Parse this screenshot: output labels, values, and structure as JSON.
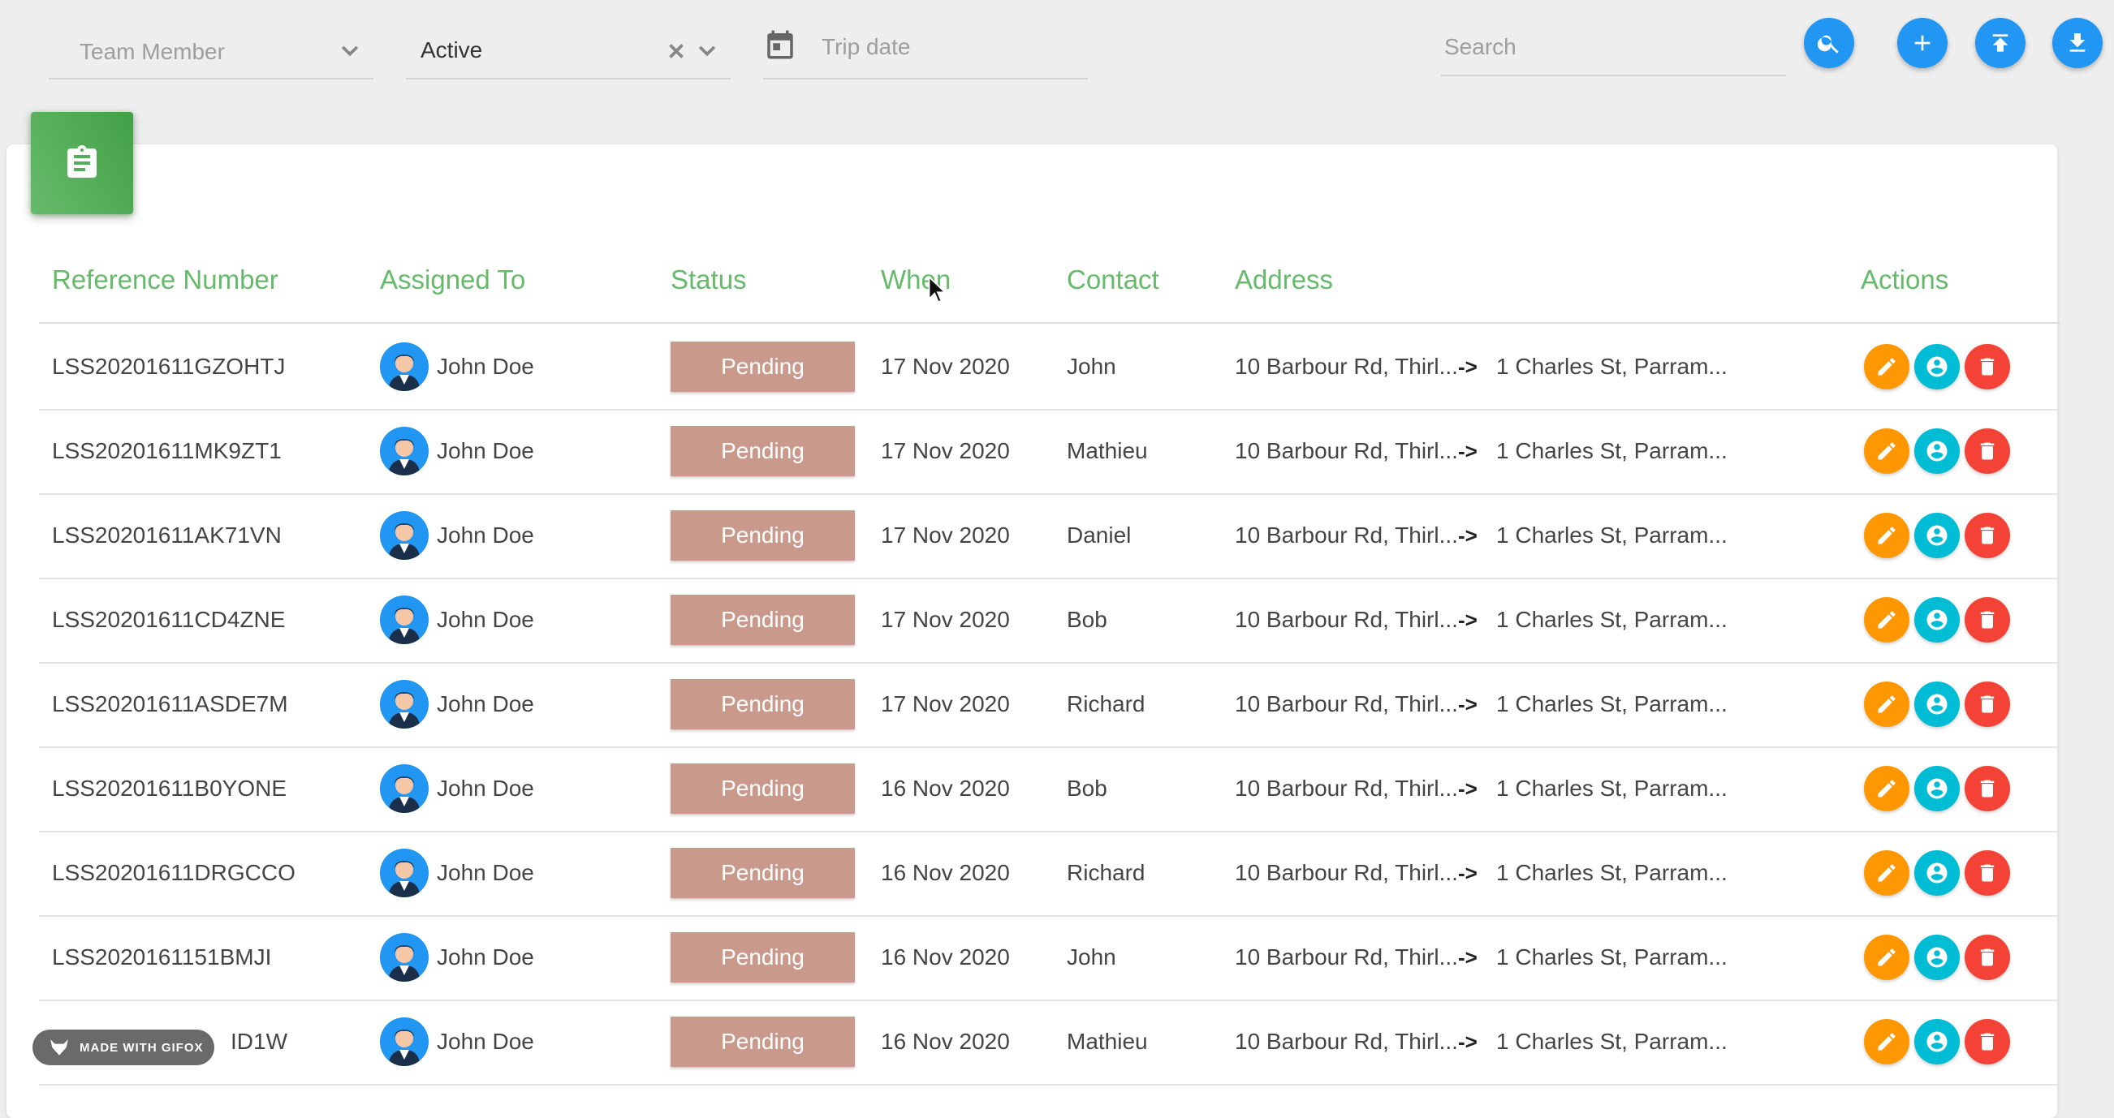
{
  "filters": {
    "team_member_placeholder": "Team Member",
    "status_value": "Active",
    "trip_date_placeholder": "Trip date",
    "search_placeholder": "Search"
  },
  "toolbar_icons": [
    "search-icon",
    "add-icon",
    "upload-icon",
    "download-icon"
  ],
  "colors": {
    "accent_blue": "#2196f3",
    "header_green": "#66bb6a",
    "pending_badge": "#c99a8b",
    "edit": "#ff9800",
    "assign": "#00bcd4",
    "delete": "#f44336"
  },
  "table": {
    "headers": {
      "reference": "Reference Number",
      "assigned": "Assigned To",
      "status": "Status",
      "when": "When",
      "contact": "Contact",
      "address": "Address",
      "actions": "Actions"
    },
    "rows": [
      {
        "reference": "LSS20201611GZOHTJ",
        "assigned": "John Doe",
        "status": "Pending",
        "when": "17 Nov 2020",
        "contact": "John",
        "from": "10 Barbour Rd, Thirl...",
        "sep": "->",
        "to": "1 Charles St, Parram..."
      },
      {
        "reference": "LSS20201611MK9ZT1",
        "assigned": "John Doe",
        "status": "Pending",
        "when": "17 Nov 2020",
        "contact": "Mathieu",
        "from": "10 Barbour Rd, Thirl...",
        "sep": "->",
        "to": "1 Charles St, Parram..."
      },
      {
        "reference": "LSS20201611AK71VN",
        "assigned": "John Doe",
        "status": "Pending",
        "when": "17 Nov 2020",
        "contact": "Daniel",
        "from": "10 Barbour Rd, Thirl...",
        "sep": "->",
        "to": "1 Charles St, Parram..."
      },
      {
        "reference": "LSS20201611CD4ZNE",
        "assigned": "John Doe",
        "status": "Pending",
        "when": "17 Nov 2020",
        "contact": "Bob",
        "from": "10 Barbour Rd, Thirl...",
        "sep": "->",
        "to": "1 Charles St, Parram..."
      },
      {
        "reference": "LSS20201611ASDE7M",
        "assigned": "John Doe",
        "status": "Pending",
        "when": "17 Nov 2020",
        "contact": "Richard",
        "from": "10 Barbour Rd, Thirl...",
        "sep": "->",
        "to": "1 Charles St, Parram..."
      },
      {
        "reference": "LSS20201611B0YONE",
        "assigned": "John Doe",
        "status": "Pending",
        "when": "16 Nov 2020",
        "contact": "Bob",
        "from": "10 Barbour Rd, Thirl...",
        "sep": "->",
        "to": "1 Charles St, Parram..."
      },
      {
        "reference": "LSS20201611DRGCCO",
        "assigned": "John Doe",
        "status": "Pending",
        "when": "16 Nov 2020",
        "contact": "Richard",
        "from": "10 Barbour Rd, Thirl...",
        "sep": "->",
        "to": "1 Charles St, Parram..."
      },
      {
        "reference": "LSS2020161151BMJI",
        "assigned": "John Doe",
        "status": "Pending",
        "when": "16 Nov 2020",
        "contact": "John",
        "from": "10 Barbour Rd, Thirl...",
        "sep": "->",
        "to": "1 Charles St, Parram..."
      },
      {
        "reference": "ID1W",
        "assigned": "John Doe",
        "status": "Pending",
        "when": "16 Nov 2020",
        "contact": "Mathieu",
        "from": "10 Barbour Rd, Thirl...",
        "sep": "->",
        "to": "1 Charles St, Parram..."
      }
    ]
  },
  "watermark": {
    "text": "MADE WITH GIFOX"
  }
}
